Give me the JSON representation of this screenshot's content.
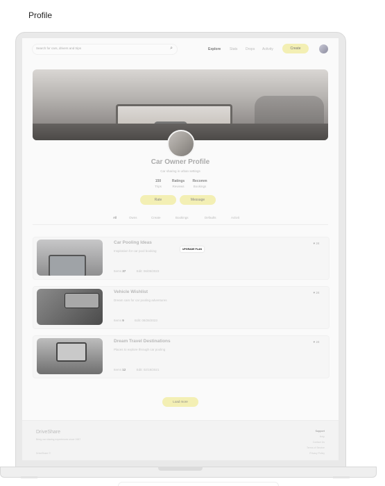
{
  "page": {
    "title": "Profile"
  },
  "nav": {
    "search_placeholder": "Search for cars, drivers and trips",
    "links": [
      "Explore",
      "Stats",
      "Drops",
      "Activity"
    ],
    "create_label": "Create"
  },
  "profile": {
    "name": "Car Owner Profile",
    "subtitle": "Car sharing in urban settings",
    "stats": [
      {
        "value": "150",
        "label": "Trips"
      },
      {
        "value": "Ratings",
        "label": "Reviews"
      },
      {
        "value": "Recomm",
        "label": "Bookings"
      }
    ],
    "rate_label": "Rate",
    "message_label": "Message"
  },
  "tabs": [
    "All",
    "Owns",
    "Create",
    "Bookings",
    "Defaults",
    "Activit"
  ],
  "collections": [
    {
      "title": "Car Pooling Ideas",
      "description": "Inspiration for car pool booking",
      "items": "37",
      "edited": "Edit: 06/05/2023",
      "likes": "24",
      "upgrade_tag": "UPGRADE PLAN"
    },
    {
      "title": "Vehicle Wishlist",
      "description": "Dream cars for car pooling adventures",
      "items": "9",
      "edited": "Edit: 08/28/2023",
      "likes": "24"
    },
    {
      "title": "Dream Travel Destinations",
      "description": "Places to explore through car pooling",
      "items": "12",
      "edited": "Edit: 02/18/2021",
      "likes": "24"
    }
  ],
  "items_label": "Items",
  "load_more_label": "Load more",
  "footer": {
    "brand": "DriveShare",
    "tagline": "Bring car sharing experiences since 1987",
    "copyright": "DriveShare ©",
    "support_heading": "Support",
    "links": [
      "Help",
      "Contact Us",
      "Terms of Service",
      "Privacy Policy"
    ]
  },
  "colors": {
    "accent_pill": "#f3efb4"
  }
}
